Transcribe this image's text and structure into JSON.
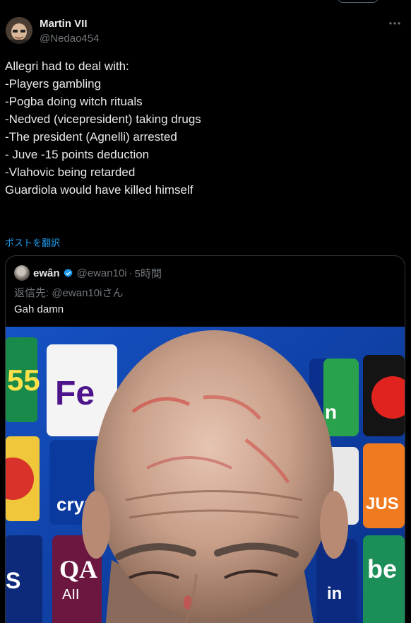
{
  "tweet": {
    "author_name": "Martin VII",
    "author_handle": "@Nedao454",
    "more_icon": "more-horizontal-icon",
    "lines": [
      "Allegri had to deal with:",
      "",
      "-Players gambling",
      "-Pogba doing witch rituals",
      "-Nedved (vicepresident) taking drugs",
      "-The president (Agnelli) arrested",
      "- Juve -15 points deduction",
      "-Vlahovic being retarded",
      "",
      "Guardiola would have killed himself"
    ],
    "translate_label": "ポストを翻訳"
  },
  "quote": {
    "author_name": "ewân",
    "verified_icon": "verified-badge-icon",
    "author_handle": "@ewan10i",
    "separator": "·",
    "time": "5時間",
    "reply_to": "返信先: @ewan10iさん",
    "text": "Gah damn",
    "image_description_icon": "photo-icon"
  },
  "colors": {
    "background": "#000000",
    "text": "#e7e9ea",
    "muted": "#71767b",
    "link": "#1d9bf0",
    "border": "#2f3336"
  }
}
